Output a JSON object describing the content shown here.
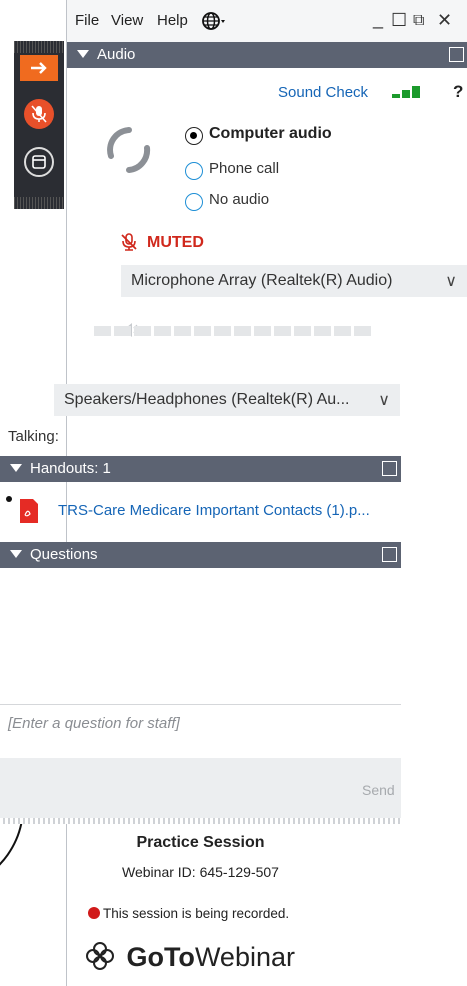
{
  "menu": {
    "file": "File",
    "view": "View",
    "help": "Help"
  },
  "window_controls": {
    "minimize": "_",
    "maximize": "☐",
    "popout": "⧉",
    "close": "✕"
  },
  "audio": {
    "header": "Audio",
    "sound_check": "Sound Check",
    "help_symbol": "?",
    "options": [
      "Computer audio",
      "Phone call",
      "No audio"
    ],
    "selected_option": "Computer audio",
    "muted_label": "MUTED",
    "microphone": "Microphone Array (Realtek(R) Audio)",
    "speakers": "Speakers/Headphones  (Realtek(R)  Au...",
    "talking_label": "Talking:",
    "mic_level_segments": 14,
    "colors": {
      "muted": "#d0281c",
      "link": "#1565b6",
      "signal": "#1c9a2c"
    }
  },
  "handouts": {
    "header": "Handouts: 1",
    "items": [
      {
        "name": "TRS-Care Medicare Important Contacts (1).p..."
      }
    ]
  },
  "questions": {
    "header": "Questions",
    "input_placeholder": "[Enter a question for staff]",
    "send_label": "Send"
  },
  "session": {
    "title": "Practice Session",
    "webinar_id": "Webinar ID: 645-129-507",
    "recording_notice": "This session is being recorded.",
    "brand_bold": "GoTo",
    "brand_light": "Webinar",
    "colors": {
      "record_dot": "#d11a1a",
      "brand": "#222222"
    }
  },
  "control_strip": {
    "icons": [
      "arrow-right-icon",
      "microphone-muted-icon",
      "webcam-icon"
    ],
    "colors": {
      "orange": "#f06b1f",
      "mic": "#e8502a"
    }
  }
}
